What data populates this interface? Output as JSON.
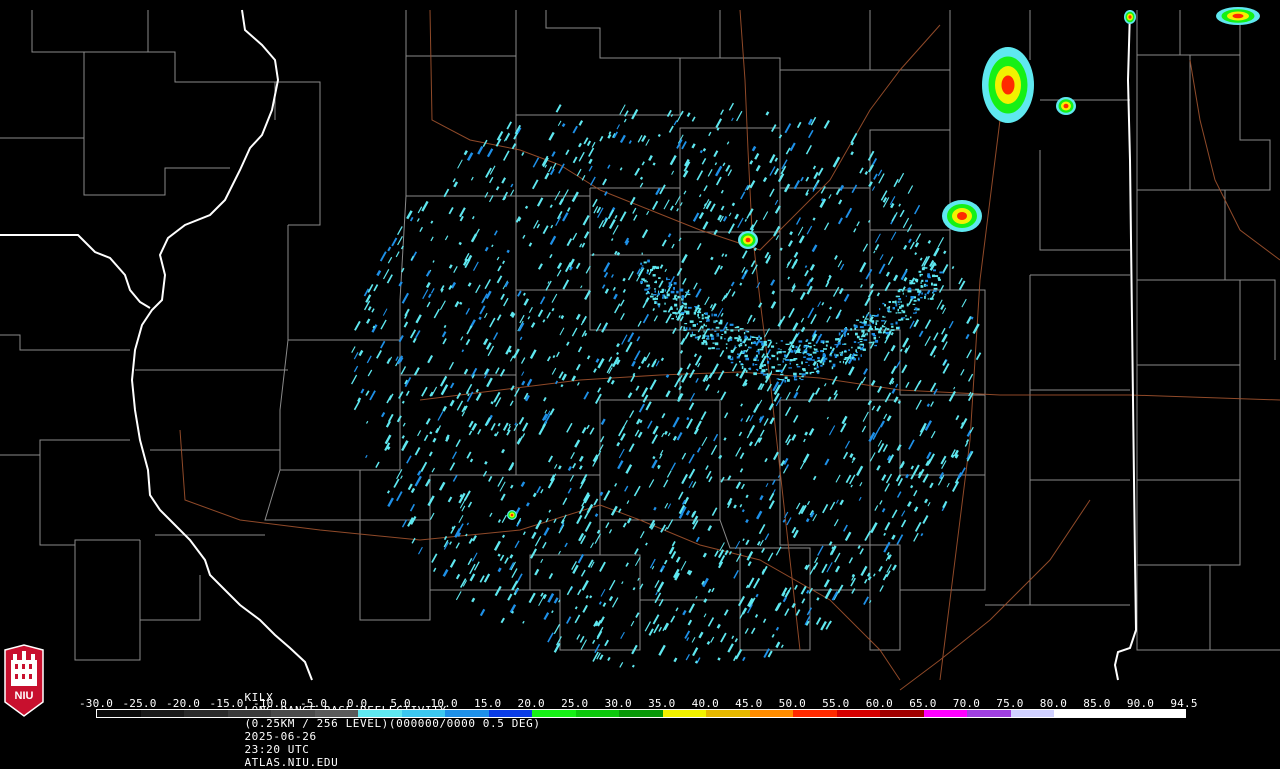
{
  "title": {
    "station": "KILX",
    "product": "LONG RANGE BASE REFLECTIVITY",
    "resolution": "(0.25KM / 256 LEVEL)",
    "volume": "(000000/0000 0.5 DEG)",
    "date": "2025-06-26",
    "time": "23:20 UTC",
    "source": "ATLAS.NIU.EDU"
  },
  "color_scale": {
    "labels": [
      "-30.0",
      "-25.0",
      "-20.0",
      "-15.0",
      "-10.0",
      "-5.0",
      "0.0",
      "5.0",
      "10.0",
      "15.0",
      "20.0",
      "25.0",
      "30.0",
      "35.0",
      "40.0",
      "45.0",
      "50.0",
      "55.0",
      "60.0",
      "65.0",
      "70.0",
      "75.0",
      "80.0",
      "85.0",
      "90.0",
      "94.5"
    ],
    "colors": [
      "#0a0a0a",
      "#1a1a1a",
      "#2a2a2a",
      "#3a3a3a",
      "#4a4a4a",
      "#5a5a5a",
      "#5fe8f0",
      "#3cc8f0",
      "#1e90e8",
      "#0a3ce6",
      "#16f016",
      "#0cc80c",
      "#089808",
      "#f2f200",
      "#e6b800",
      "#ff8c00",
      "#ff2a00",
      "#d60000",
      "#a00000",
      "#ff00ff",
      "#a040e0",
      "#d0d0ff",
      "#ffffff",
      "#ffffff",
      "#ffffff"
    ],
    "min_dbz": -30.0,
    "max_dbz": 94.5
  },
  "logo": {
    "text": "NIU",
    "colors": {
      "seal": "#c8102e",
      "ink": "#ffffff"
    }
  },
  "map_colors": {
    "background": "#000000",
    "state_border": "#ffffff",
    "county_border": "#8a8a8a",
    "road": "#a0522d",
    "echo_light": "#5fe8f0",
    "echo_mid": "#1e90e8",
    "echo_green": "#16f016",
    "echo_yellow": "#f2f200",
    "echo_red": "#ff2a00"
  }
}
